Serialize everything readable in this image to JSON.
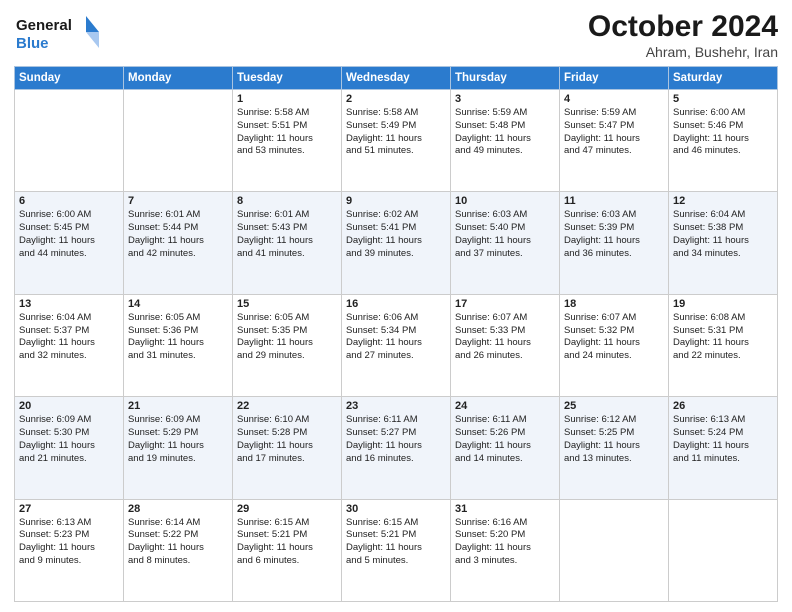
{
  "logo": {
    "line1": "General",
    "line2": "Blue"
  },
  "title": "October 2024",
  "subtitle": "Ahram, Bushehr, Iran",
  "days_of_week": [
    "Sunday",
    "Monday",
    "Tuesday",
    "Wednesday",
    "Thursday",
    "Friday",
    "Saturday"
  ],
  "weeks": [
    [
      {
        "day": null,
        "content": []
      },
      {
        "day": null,
        "content": []
      },
      {
        "day": "1",
        "content": [
          "Sunrise: 5:58 AM",
          "Sunset: 5:51 PM",
          "Daylight: 11 hours",
          "and 53 minutes."
        ]
      },
      {
        "day": "2",
        "content": [
          "Sunrise: 5:58 AM",
          "Sunset: 5:49 PM",
          "Daylight: 11 hours",
          "and 51 minutes."
        ]
      },
      {
        "day": "3",
        "content": [
          "Sunrise: 5:59 AM",
          "Sunset: 5:48 PM",
          "Daylight: 11 hours",
          "and 49 minutes."
        ]
      },
      {
        "day": "4",
        "content": [
          "Sunrise: 5:59 AM",
          "Sunset: 5:47 PM",
          "Daylight: 11 hours",
          "and 47 minutes."
        ]
      },
      {
        "day": "5",
        "content": [
          "Sunrise: 6:00 AM",
          "Sunset: 5:46 PM",
          "Daylight: 11 hours",
          "and 46 minutes."
        ]
      }
    ],
    [
      {
        "day": "6",
        "content": [
          "Sunrise: 6:00 AM",
          "Sunset: 5:45 PM",
          "Daylight: 11 hours",
          "and 44 minutes."
        ]
      },
      {
        "day": "7",
        "content": [
          "Sunrise: 6:01 AM",
          "Sunset: 5:44 PM",
          "Daylight: 11 hours",
          "and 42 minutes."
        ]
      },
      {
        "day": "8",
        "content": [
          "Sunrise: 6:01 AM",
          "Sunset: 5:43 PM",
          "Daylight: 11 hours",
          "and 41 minutes."
        ]
      },
      {
        "day": "9",
        "content": [
          "Sunrise: 6:02 AM",
          "Sunset: 5:41 PM",
          "Daylight: 11 hours",
          "and 39 minutes."
        ]
      },
      {
        "day": "10",
        "content": [
          "Sunrise: 6:03 AM",
          "Sunset: 5:40 PM",
          "Daylight: 11 hours",
          "and 37 minutes."
        ]
      },
      {
        "day": "11",
        "content": [
          "Sunrise: 6:03 AM",
          "Sunset: 5:39 PM",
          "Daylight: 11 hours",
          "and 36 minutes."
        ]
      },
      {
        "day": "12",
        "content": [
          "Sunrise: 6:04 AM",
          "Sunset: 5:38 PM",
          "Daylight: 11 hours",
          "and 34 minutes."
        ]
      }
    ],
    [
      {
        "day": "13",
        "content": [
          "Sunrise: 6:04 AM",
          "Sunset: 5:37 PM",
          "Daylight: 11 hours",
          "and 32 minutes."
        ]
      },
      {
        "day": "14",
        "content": [
          "Sunrise: 6:05 AM",
          "Sunset: 5:36 PM",
          "Daylight: 11 hours",
          "and 31 minutes."
        ]
      },
      {
        "day": "15",
        "content": [
          "Sunrise: 6:05 AM",
          "Sunset: 5:35 PM",
          "Daylight: 11 hours",
          "and 29 minutes."
        ]
      },
      {
        "day": "16",
        "content": [
          "Sunrise: 6:06 AM",
          "Sunset: 5:34 PM",
          "Daylight: 11 hours",
          "and 27 minutes."
        ]
      },
      {
        "day": "17",
        "content": [
          "Sunrise: 6:07 AM",
          "Sunset: 5:33 PM",
          "Daylight: 11 hours",
          "and 26 minutes."
        ]
      },
      {
        "day": "18",
        "content": [
          "Sunrise: 6:07 AM",
          "Sunset: 5:32 PM",
          "Daylight: 11 hours",
          "and 24 minutes."
        ]
      },
      {
        "day": "19",
        "content": [
          "Sunrise: 6:08 AM",
          "Sunset: 5:31 PM",
          "Daylight: 11 hours",
          "and 22 minutes."
        ]
      }
    ],
    [
      {
        "day": "20",
        "content": [
          "Sunrise: 6:09 AM",
          "Sunset: 5:30 PM",
          "Daylight: 11 hours",
          "and 21 minutes."
        ]
      },
      {
        "day": "21",
        "content": [
          "Sunrise: 6:09 AM",
          "Sunset: 5:29 PM",
          "Daylight: 11 hours",
          "and 19 minutes."
        ]
      },
      {
        "day": "22",
        "content": [
          "Sunrise: 6:10 AM",
          "Sunset: 5:28 PM",
          "Daylight: 11 hours",
          "and 17 minutes."
        ]
      },
      {
        "day": "23",
        "content": [
          "Sunrise: 6:11 AM",
          "Sunset: 5:27 PM",
          "Daylight: 11 hours",
          "and 16 minutes."
        ]
      },
      {
        "day": "24",
        "content": [
          "Sunrise: 6:11 AM",
          "Sunset: 5:26 PM",
          "Daylight: 11 hours",
          "and 14 minutes."
        ]
      },
      {
        "day": "25",
        "content": [
          "Sunrise: 6:12 AM",
          "Sunset: 5:25 PM",
          "Daylight: 11 hours",
          "and 13 minutes."
        ]
      },
      {
        "day": "26",
        "content": [
          "Sunrise: 6:13 AM",
          "Sunset: 5:24 PM",
          "Daylight: 11 hours",
          "and 11 minutes."
        ]
      }
    ],
    [
      {
        "day": "27",
        "content": [
          "Sunrise: 6:13 AM",
          "Sunset: 5:23 PM",
          "Daylight: 11 hours",
          "and 9 minutes."
        ]
      },
      {
        "day": "28",
        "content": [
          "Sunrise: 6:14 AM",
          "Sunset: 5:22 PM",
          "Daylight: 11 hours",
          "and 8 minutes."
        ]
      },
      {
        "day": "29",
        "content": [
          "Sunrise: 6:15 AM",
          "Sunset: 5:21 PM",
          "Daylight: 11 hours",
          "and 6 minutes."
        ]
      },
      {
        "day": "30",
        "content": [
          "Sunrise: 6:15 AM",
          "Sunset: 5:21 PM",
          "Daylight: 11 hours",
          "and 5 minutes."
        ]
      },
      {
        "day": "31",
        "content": [
          "Sunrise: 6:16 AM",
          "Sunset: 5:20 PM",
          "Daylight: 11 hours",
          "and 3 minutes."
        ]
      },
      {
        "day": null,
        "content": []
      },
      {
        "day": null,
        "content": []
      }
    ]
  ]
}
